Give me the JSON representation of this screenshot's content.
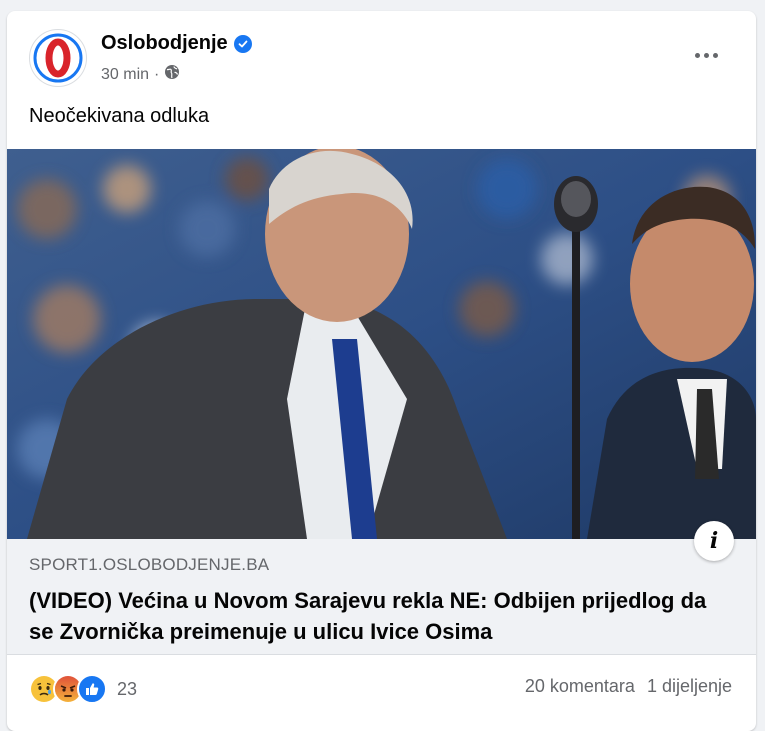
{
  "post": {
    "page_name": "Oslobodjenje",
    "timestamp": "30 min",
    "separator": "·",
    "text": "Neočekivana odluka"
  },
  "link": {
    "domain": "SPORT1.OSLOBODJENJE.BA",
    "headline": "(VIDEO) Većina u Novom Sarajevu rekla NE: Odbijen prijedlog da se Zvornička preimenuje u ulicu Ivice Osima",
    "info_icon": "i"
  },
  "footer": {
    "reaction_count": "23",
    "comments": "20 komentara",
    "shares": "1 dijeljenje"
  },
  "colors": {
    "brand_blue": "#1877f2",
    "logo_red": "#d9242b",
    "secondary_text": "#65676b",
    "link_bar_bg": "#f0f2f5"
  },
  "icons": {
    "verified": "verified-badge-icon",
    "audience": "globe-icon",
    "more": "more-options-icon",
    "info": "info-icon",
    "reactions": [
      "sad-reaction-icon",
      "angry-reaction-icon",
      "like-reaction-icon"
    ]
  }
}
